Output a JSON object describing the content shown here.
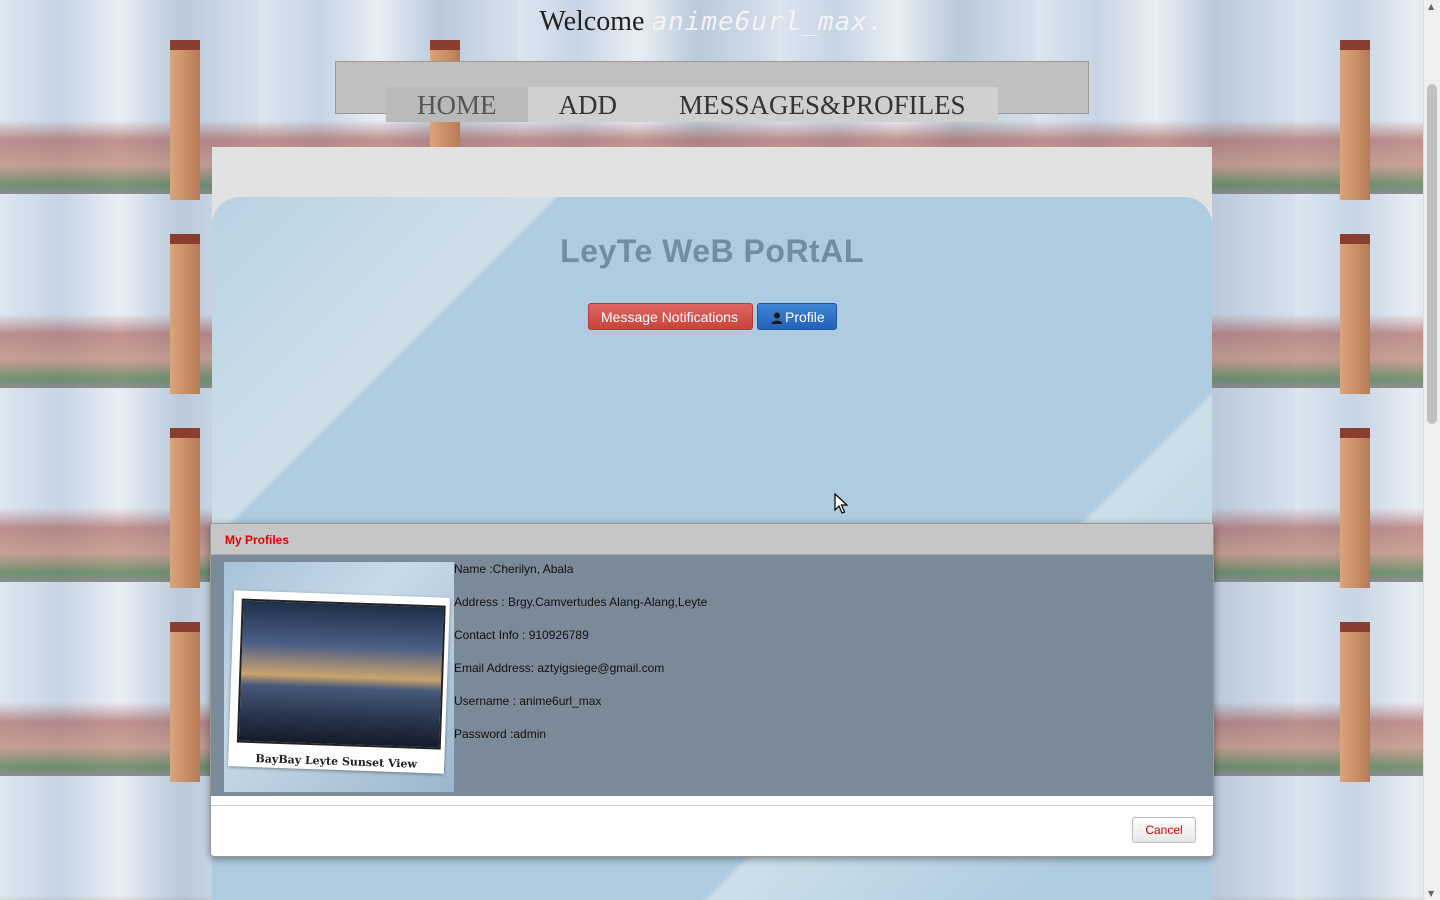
{
  "header": {
    "welcome_text": "Welcome ",
    "username": "anime6url_max."
  },
  "nav": {
    "items": [
      {
        "label": "HOME",
        "active": true
      },
      {
        "label": "ADD",
        "active": false
      },
      {
        "label": "MESSAGES&PROFILES",
        "active": false
      }
    ]
  },
  "hero": {
    "title": "LeyTe WeB PoRtAL",
    "message_button": "Message Notifications",
    "profile_button": "Profile",
    "profile_icon": "user-icon"
  },
  "modal": {
    "title": "My Profiles",
    "photo_caption": "BayBay Leyte Sunset View",
    "details": [
      "Name :Cherilyn, Abala",
      "Address : Brgy.Camvertudes Alang-Alang,Leyte",
      "Contact Info : 910926789",
      "Email Address: aztyigsiege@gmail.com",
      "Username : anime6url_max",
      "Password :admin"
    ],
    "cancel_button": "Cancel"
  },
  "colors": {
    "danger": "#d9534f",
    "primary": "#2f70c4",
    "modal_title": "#e00000"
  }
}
